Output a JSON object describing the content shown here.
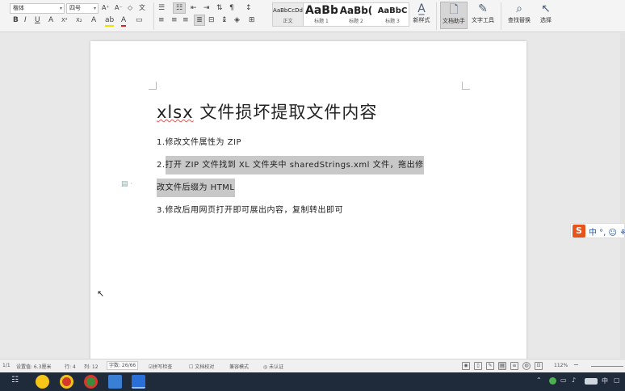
{
  "ribbon": {
    "font_name": "楷体",
    "font_size": "四号",
    "styles": [
      {
        "preview": "AaBbCcDd",
        "label": "正文"
      },
      {
        "preview": "AaBb",
        "label": "标题 1"
      },
      {
        "preview": "AaBb(",
        "label": "标题 2"
      },
      {
        "preview": "AaBbC",
        "label": "标题 3"
      }
    ],
    "new_style": "新样式",
    "doc_assistant": "文档助手",
    "text_tools": "文字工具",
    "find_replace": "查找替换",
    "select": "选择"
  },
  "document": {
    "title_prefix": "xlsx",
    "title_rest": " 文件损坏提取文件内容",
    "line1": "1.修改文件属性为 ZIP",
    "line2a_num": "2.",
    "line2a": "打开 ZIP 文件找到 XL 文件夹中 sharedStrings.xml 文件，拖出修",
    "line2b": "改文件后缀为 HTML",
    "line3": "3.修改后用网页打开即可展出内容，复制转出即可"
  },
  "ime": {
    "logo": "S",
    "text": "中 °, ☺ ⚘"
  },
  "status": {
    "page": "1/1",
    "setting": "设置值: 6.3厘米",
    "row": "行: 4",
    "col": "列: 12",
    "word_count": "字数: 26/66",
    "spell_check": "拼写检查",
    "doc_proof": "文档校对",
    "compat_mode": "兼容模式",
    "unverified": "未认证",
    "zoom": "112%"
  },
  "taskbar": {
    "time": "中"
  },
  "colors": {
    "accent": "#2b579a",
    "highlight": "#c8c8c8",
    "ime_logo": "#e8531c",
    "taskbar": "#1f2a3a"
  }
}
